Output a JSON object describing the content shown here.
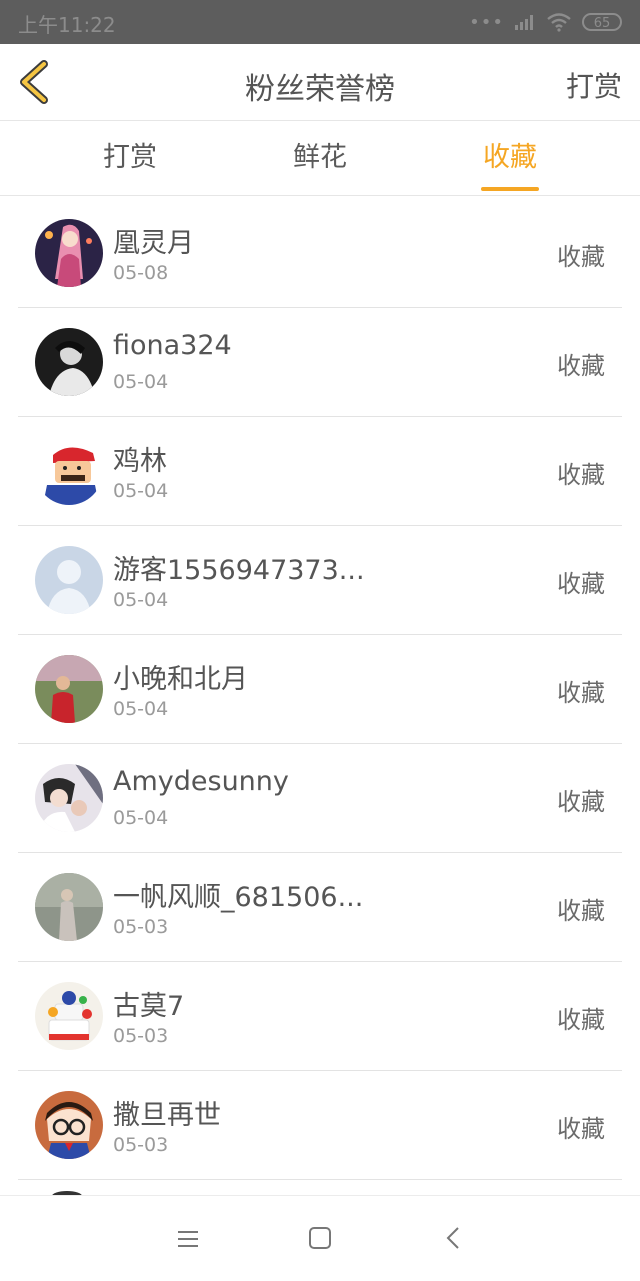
{
  "status_bar": {
    "time": "上午11:22",
    "battery": "65"
  },
  "header": {
    "title": "粉丝荣誉榜",
    "action_label": "打赏"
  },
  "tabs": [
    {
      "label": "打赏",
      "active": false
    },
    {
      "label": "鲜花",
      "active": false
    },
    {
      "label": "收藏",
      "active": true
    }
  ],
  "accent_color": "#f5a623",
  "list": [
    {
      "name": "凰灵月",
      "date": "05-08",
      "action": "收藏",
      "avatar_icon": "anime-girl-avatar"
    },
    {
      "name": "fiona324",
      "date": "05-04",
      "action": "收藏",
      "avatar_icon": "photo-person-avatar"
    },
    {
      "name": "鸡林",
      "date": "05-04",
      "action": "收藏",
      "avatar_icon": "mario-avatar"
    },
    {
      "name": "游客1556947373...",
      "date": "05-04",
      "action": "收藏",
      "avatar_icon": "default-user-avatar"
    },
    {
      "name": "小晚和北月",
      "date": "05-04",
      "action": "收藏",
      "avatar_icon": "photo-person-avatar"
    },
    {
      "name": "Amydesunny",
      "date": "05-04",
      "action": "收藏",
      "avatar_icon": "photo-couple-avatar"
    },
    {
      "name": "一帆风顺_681506...",
      "date": "05-03",
      "action": "收藏",
      "avatar_icon": "photo-girl-avatar"
    },
    {
      "name": "古莫7",
      "date": "05-03",
      "action": "收藏",
      "avatar_icon": "cake-avatar"
    },
    {
      "name": "撒旦再世",
      "date": "05-03",
      "action": "收藏",
      "avatar_icon": "detective-cartoon-avatar"
    }
  ],
  "nav_bar": {
    "icons": [
      "menu-icon",
      "home-square-icon",
      "back-arrow-icon"
    ]
  }
}
